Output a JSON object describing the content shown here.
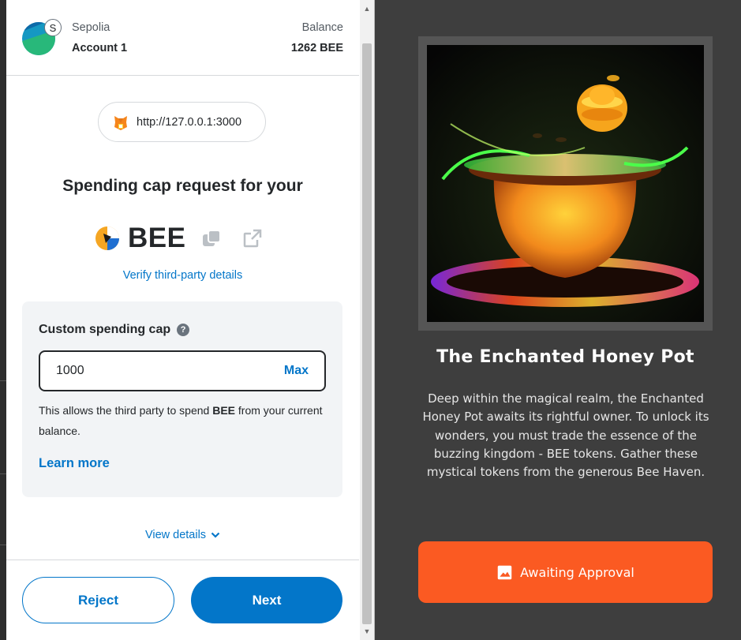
{
  "wallet": {
    "network": "Sepolia",
    "network_badge": "S",
    "account": "Account 1",
    "balance_label": "Balance",
    "balance_value": "1262 BEE",
    "origin": "http://127.0.0.1:3000",
    "heading": "Spending cap request for your",
    "token_symbol": "BEE",
    "verify_link": "Verify third-party details",
    "custom_cap_label": "Custom spending cap",
    "cap_value": "1000",
    "max_label": "Max",
    "note_before": "This allows the third party to spend ",
    "note_token": "BEE",
    "note_after": " from your current balance.",
    "learn_more": "Learn more",
    "view_details": "View details",
    "reject_label": "Reject",
    "next_label": "Next"
  },
  "dapp": {
    "nft_title": "The Enchanted Honey Pot",
    "nft_description": "Deep within the magical realm, the Enchanted Honey Pot awaits its rightful owner. To unlock its wonders, you must trade the essence of the buzzing kingdom - BEE tokens. Gather these mystical tokens from the generous Bee Haven.",
    "button_label": "Awaiting Approval"
  },
  "colors": {
    "accent_blue": "#0376c9",
    "approval_orange": "#fb5a22",
    "page_background": "#3e3e3e"
  },
  "icons": [
    "fox-icon",
    "copy-icon",
    "external-link-icon",
    "help-icon",
    "chevron-down-icon",
    "image-icon"
  ]
}
